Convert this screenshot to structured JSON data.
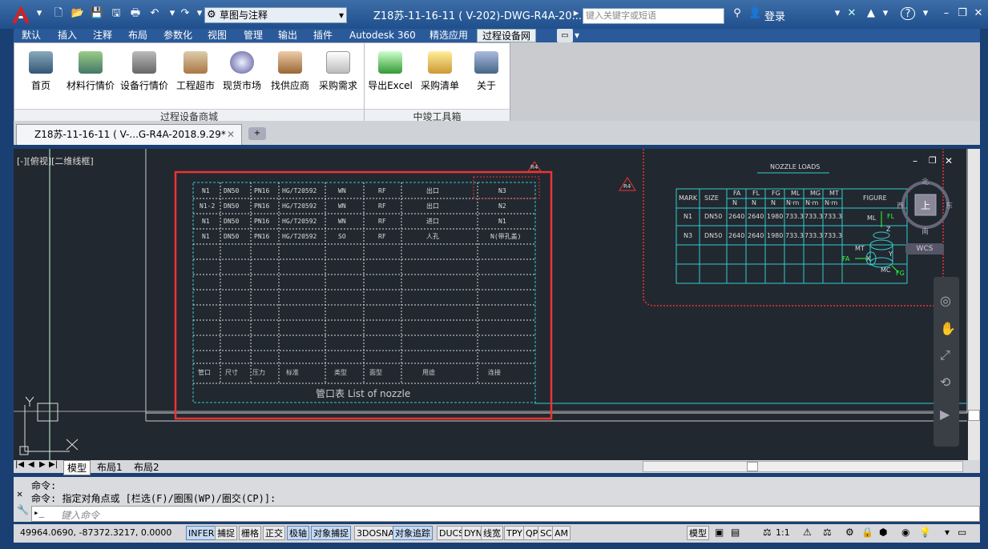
{
  "titlebar": {
    "workspace": "草图与注释",
    "doc_title": "Z18苏-11-16-11 ( V-202)-DWG-R4A-20...",
    "search_placeholder": "键入关键字或短语",
    "login": "登录",
    "help": "?"
  },
  "menu": [
    "默认",
    "插入",
    "注释",
    "布局",
    "参数化",
    "视图",
    "管理",
    "输出",
    "插件",
    "Autodesk 360",
    "精选应用",
    "过程设备网"
  ],
  "ribbon": {
    "buttons": [
      "首页",
      "材料行情价",
      "设备行情价",
      "工程超市",
      "现货市场",
      "找供应商",
      "采购需求",
      "导出Excel",
      "采购清单",
      "关于"
    ],
    "groups": [
      "过程设备商城",
      "中竣工具箱"
    ]
  },
  "doctab": "Z18苏-11-16-11 ( V-...G-R4A-2018.9.29*",
  "canvas": {
    "viewport_label": "[-][俯视][二维线框]",
    "rev_tags": [
      "R4",
      "R4"
    ],
    "nozzle_title": "NOZZLE LOADS",
    "nozzle_headers": [
      "MARK",
      "SIZE",
      "FA",
      "FL",
      "FG",
      "ML",
      "MG",
      "MT",
      "FIGURE"
    ],
    "nozzle_units": [
      "N",
      "N",
      "N",
      "N·m",
      "N·m",
      "N·m"
    ],
    "nozzle_rows": [
      [
        "N1",
        "DN50",
        "2640",
        "2640",
        "1980",
        "733.3",
        "733.3",
        "733.3"
      ],
      [
        "N3",
        "DN50",
        "2640",
        "2640",
        "1980",
        "733.3",
        "733.3",
        "733.3"
      ]
    ],
    "figure_labels": [
      "ML",
      "FL",
      "Z",
      "MT",
      "X",
      "Y",
      "FA",
      "MC",
      "FG"
    ],
    "table_bottom": "管口表  List of nozzle",
    "compass": {
      "n": "北",
      "s": "南",
      "e": "东",
      "w": "西",
      "top": "上",
      "wcs": "WCS"
    }
  },
  "layout_tabs": [
    "模型",
    "布局1",
    "布局2"
  ],
  "command": {
    "line1": "命令:",
    "line2": "命令: 指定对角点或 [栏选(F)/圈围(WP)/圈交(CP)]:",
    "placeholder": "键入命令"
  },
  "status": {
    "coords": "49964.0690, -87372.3217, 0.0000",
    "toggles": [
      "INFER",
      "捕捉",
      "栅格",
      "正交",
      "极轴",
      "对象捕捉",
      "3DOSNAP",
      "对象追踪",
      "DUCS",
      "DYN",
      "线宽",
      "TPY",
      "QP",
      "SC",
      "AM"
    ],
    "model": "模型",
    "scale": "1:1"
  }
}
